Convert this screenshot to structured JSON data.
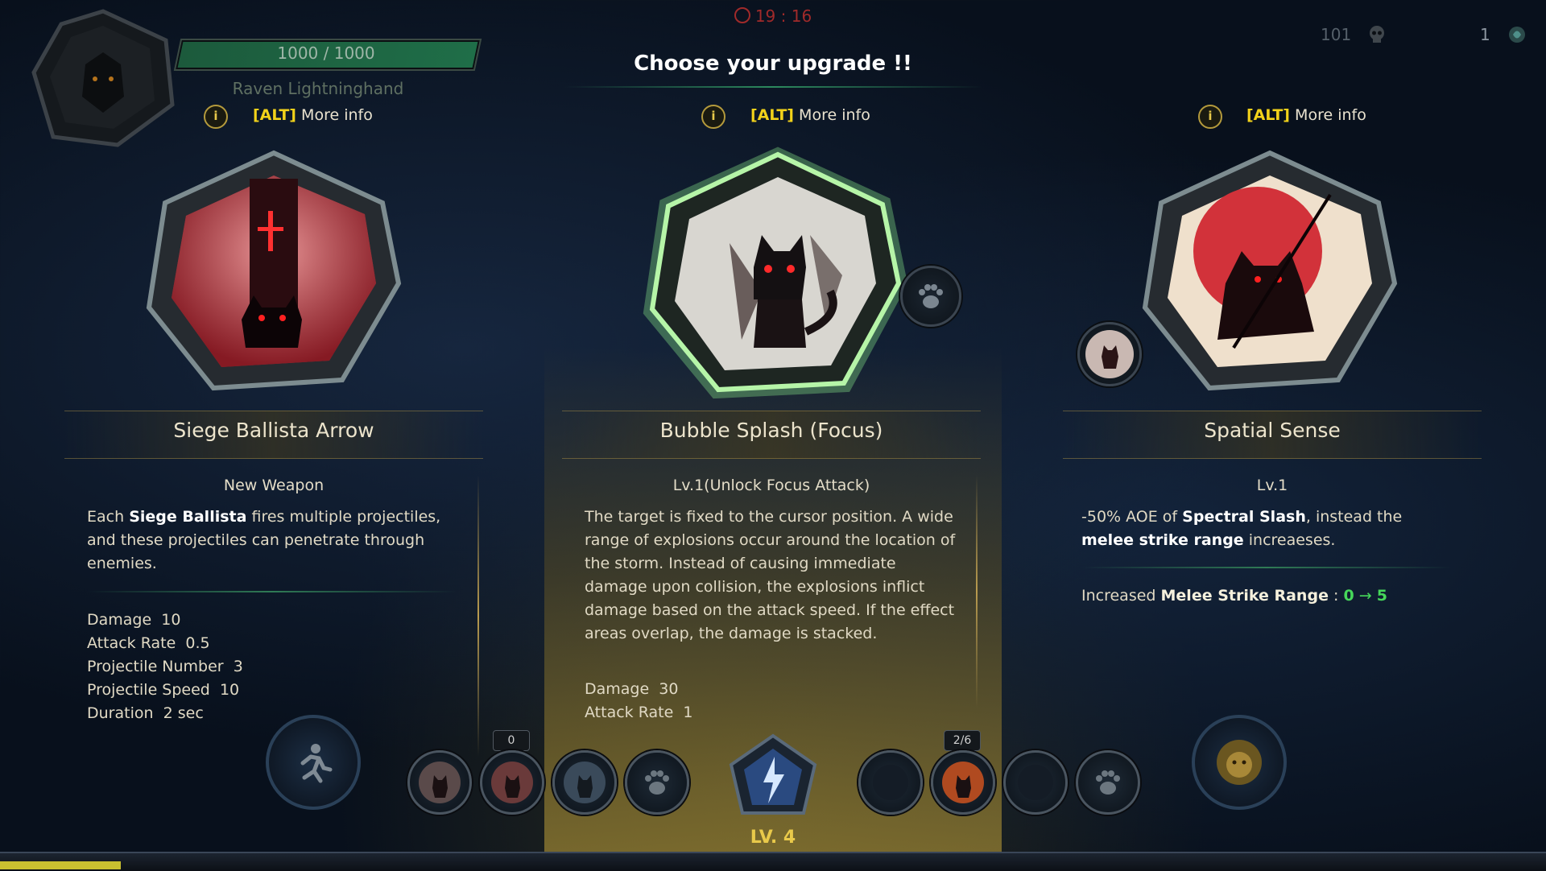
{
  "hud": {
    "hp_text": "1000 / 1000",
    "player_name": "Raven Lightninghand",
    "timer": "19 : 16",
    "kills": "101",
    "gems": "1",
    "heading": "Choose your upgrade !!"
  },
  "info_prompt": {
    "alt_key": "[ALT]",
    "label": "More info"
  },
  "cards": [
    {
      "title": "Siege Ballista Arrow",
      "subtitle": "New Weapon",
      "desc_pre": "Each ",
      "desc_hl": "Siege Ballista",
      "desc_post": " fires multiple projectiles, and these projectiles can penetrate through enemies.",
      "stats": [
        {
          "label": "Damage",
          "value": "10"
        },
        {
          "label": "Attack Rate",
          "value": "0.5"
        },
        {
          "label": "Projectile Number",
          "value": "3"
        },
        {
          "label": "Projectile Speed",
          "value": "10"
        },
        {
          "label": "Duration",
          "value": "2 sec"
        }
      ]
    },
    {
      "title": "Bubble Splash (Focus)",
      "subtitle": "Lv.1(Unlock Focus Attack)",
      "desc": "The target is fixed to the cursor position. A wide range of explosions occur around the location of the storm. Instead of causing immediate damage upon collision, the explosions inflict damage based on the attack speed. If the effect areas overlap, the damage is stacked.",
      "stats": [
        {
          "label": "Damage",
          "value": "30"
        },
        {
          "label": "Attack Rate",
          "value": "1"
        }
      ]
    },
    {
      "title": "Spatial Sense",
      "subtitle": "Lv.1",
      "desc_pre": "-50% AOE of ",
      "desc_hl1": "Spectral Slash",
      "desc_mid": ", instead the ",
      "desc_hl2": "melee strike range",
      "desc_post": " increaeses.",
      "increase_label": "Increased ",
      "increase_hl": "Melee Strike Range",
      "increase_colon": " : ",
      "increase_from": "0",
      "increase_arrow": "→",
      "increase_to": "5"
    }
  ],
  "skillbar": {
    "left_count": "0",
    "right_count": "2/6",
    "level": "LV. 4"
  },
  "colors": {
    "accent_gold": "#e9c94a",
    "alt_yellow": "#f2d21a",
    "highlight_green": "#46d75a",
    "hp_green": "#1f6e48",
    "timer_red": "#a02a2a"
  },
  "icons": [
    "paw-icon",
    "skull-icon",
    "gem-icon",
    "clock-icon",
    "info-icon",
    "run-icon",
    "lion-icon",
    "lightning-gem-icon"
  ]
}
